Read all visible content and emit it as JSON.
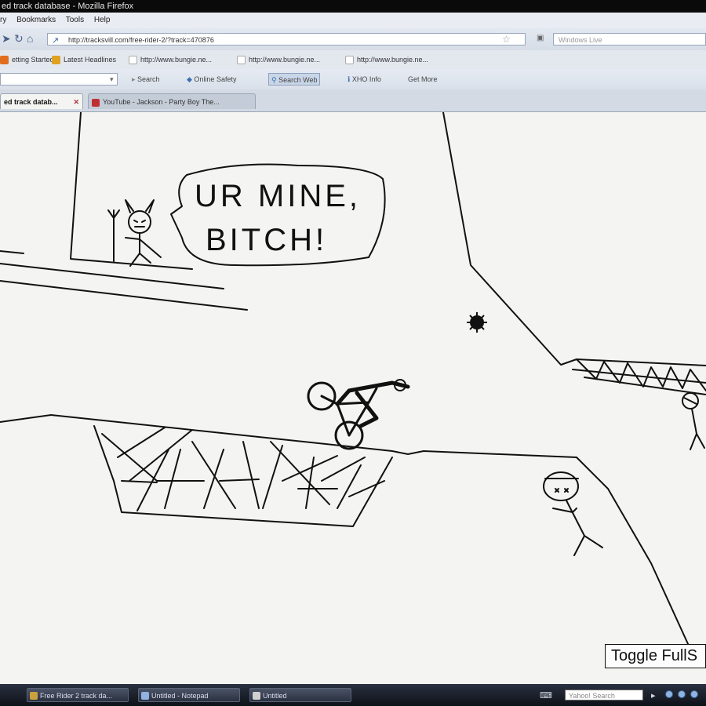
{
  "window": {
    "title": "ed track database - Mozilla Firefox"
  },
  "menu": {
    "items": [
      "ry",
      "Bookmarks",
      "Tools",
      "Help"
    ]
  },
  "nav": {
    "url": "http://tracksvill.com/free-rider-2/?track=470876",
    "search_placeholder": "Windows Live"
  },
  "bookmarks": {
    "items": [
      {
        "label": "etting Started",
        "icon_color": "#e07020"
      },
      {
        "label": "Latest Headlines",
        "icon_color": "#e0a020"
      },
      {
        "label": "http://www.bungie.ne...",
        "icon_color": "#ffffff"
      },
      {
        "label": "http://www.bungie.ne...",
        "icon_color": "#ffffff"
      },
      {
        "label": "http://www.bungie.ne...",
        "icon_color": "#ffffff"
      }
    ]
  },
  "toolbar2": {
    "search_label": "Search",
    "items": [
      "Online Safety",
      "Search Web",
      "XHO Info",
      "Get More"
    ]
  },
  "tabs": [
    {
      "label": "ed track datab...",
      "active": true
    },
    {
      "label": "YouTube - Jackson - Party Boy The...",
      "active": false
    }
  ],
  "game": {
    "speech_bubble": {
      "line1": "UR MINE,",
      "line2": "BITCH!"
    },
    "toggle_button_label": "Toggle FullS",
    "colors": {
      "ink": "#111111",
      "background": "#f4f4f2"
    }
  },
  "taskbar": {
    "tasks": [
      "Free Rider 2 track da...",
      "Untitled - Notepad",
      "Untitled"
    ],
    "search_placeholder": "Yahoo! Search"
  }
}
